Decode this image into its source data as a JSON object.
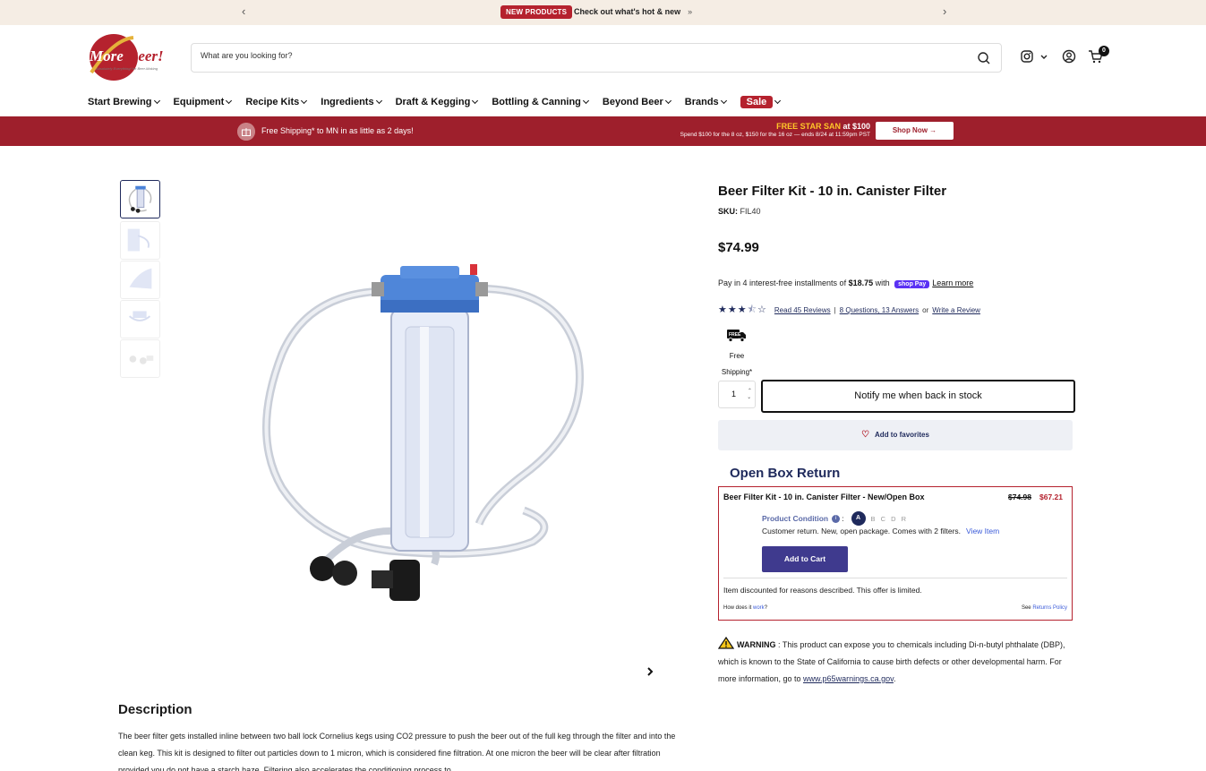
{
  "announcement": {
    "badge": "NEW PRODUCTS",
    "message": "Check out what's hot & new",
    "chevron": "»",
    "prev_icon": "chevron-left-icon",
    "next_icon": "chevron-right-icon"
  },
  "header": {
    "logo_text": "More Beer!",
    "search": {
      "placeholder": "What are you looking for?"
    },
    "icons": [
      "search-icon",
      "instagram-icon",
      "account-icon",
      "cart-icon"
    ],
    "cart_count": "0"
  },
  "nav": {
    "items": [
      {
        "label": "Start Brewing"
      },
      {
        "label": "Equipment"
      },
      {
        "label": "Recipe Kits"
      },
      {
        "label": "Ingredients"
      },
      {
        "label": "Draft & Kegging"
      },
      {
        "label": "Bottling & Canning"
      },
      {
        "label": "Beyond Beer"
      },
      {
        "label": "Brands"
      },
      {
        "label": "Sale"
      }
    ]
  },
  "promo": {
    "shipping": "Free Shipping* to MN in as little as 2 days!",
    "star_san_highlight": "FREE STAR SAN",
    "star_san_tail": " at $100",
    "star_san_detail": "Spend $100 for the 8 oz, $150 for the 16 oz — ends 8/24 at 11:59pm PST",
    "shop_now": "Shop Now →"
  },
  "product": {
    "title": "Beer Filter Kit - 10 in. Canister Filter",
    "sku_label": "SKU:",
    "sku": "FIL40",
    "price": "$74.99",
    "installments": {
      "prefix": "Pay in 4 interest-free installments of ",
      "amount": "$18.75",
      "middle": " with ",
      "shop_pay": "shop Pay",
      "learn_more": "Learn more"
    },
    "rating": 3.5,
    "reviews": {
      "read": "Read 45 Reviews",
      "separator": "|",
      "questions": "8 Questions, 13 Answers",
      "or": "or",
      "write": "Write a Review"
    },
    "free_shipping_label": "Free Shipping*",
    "quantity": "1",
    "notify_button": "Notify me when back in stock",
    "favorites_button": "Add to favorites"
  },
  "gallery": {
    "thumbnails": [
      "thumb-1",
      "thumb-2",
      "thumb-3",
      "thumb-4",
      "thumb-5"
    ]
  },
  "open_box": {
    "heading": "Open Box Return",
    "name": "Beer Filter Kit - 10 in. Canister Filter - New/Open Box",
    "old_price": "$74.98",
    "new_price": "$67.21",
    "condition_label": "Product Condition",
    "condition_colon": ":",
    "condition_grade": "A",
    "other_grades": "B C D R",
    "condition_desc": "Customer return. New, open package. Comes with 2 filters.",
    "view_item": "View Item",
    "add_to_cart": "Add to Cart",
    "offer_note": "Item discounted for reasons described. This offer is limited.",
    "how_prefix": "How does it ",
    "how_link": "work",
    "how_suffix": "?",
    "see_prefix": "See ",
    "returns_link": "Returns Policy"
  },
  "warning": {
    "label": "WARNING",
    "text": " : This product can expose you to chemicals including Di-n-butyl phthalate (DBP), which is known to the State of California to cause birth defects or other developmental harm. For more information, go to ",
    "link": "www.p65warnings.ca.gov",
    "end": "."
  },
  "description": {
    "title": "Description",
    "text": "The beer filter gets installed inline between two ball lock Cornelius kegs using CO2 pressure to push the beer out of the full keg through the filter and into the clean keg. This kit is designed to filter out particles down to 1 micron, which is considered fine filtration. At one micron the beer will be clear after filtration provided you do not have a starch haze. Filtering also accelerates the conditioning process to"
  },
  "colors": {
    "brand_red": "#b5222e",
    "promo_red": "#9e1f2c",
    "navy": "#1f2a5c",
    "announce_bg": "#f5ede4"
  }
}
